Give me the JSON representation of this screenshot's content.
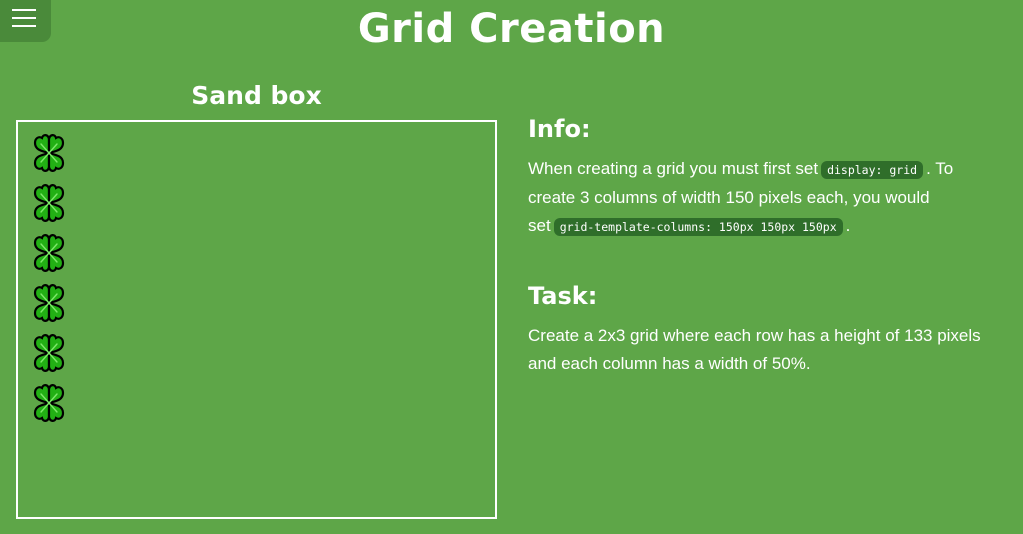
{
  "page": {
    "title": "Grid Creation"
  },
  "menu": {
    "icon": "hamburger-menu-icon"
  },
  "sandbox": {
    "title": "Sand box",
    "item_icon": "four-leaf-clover-icon",
    "item_count": 6
  },
  "info": {
    "title": "Info:",
    "text_1": "When creating a grid you must first set",
    "code_1": "display: grid",
    "text_2": ". To create 3 columns of width 150 pixels each, you would set",
    "code_2": "grid-template-columns: 150px 150px 150px",
    "text_3": "."
  },
  "task": {
    "title": "Task:",
    "text": "Create a 2x3 grid where each row has a height of 133 pixels and each column has a width of 50%."
  },
  "colors": {
    "background": "#5ea648",
    "menu_button": "#4a8a3a",
    "code_background": "#2f6e2a",
    "text": "#ffffff",
    "clover_leaf": "#22b014",
    "clover_outline": "#000000"
  }
}
